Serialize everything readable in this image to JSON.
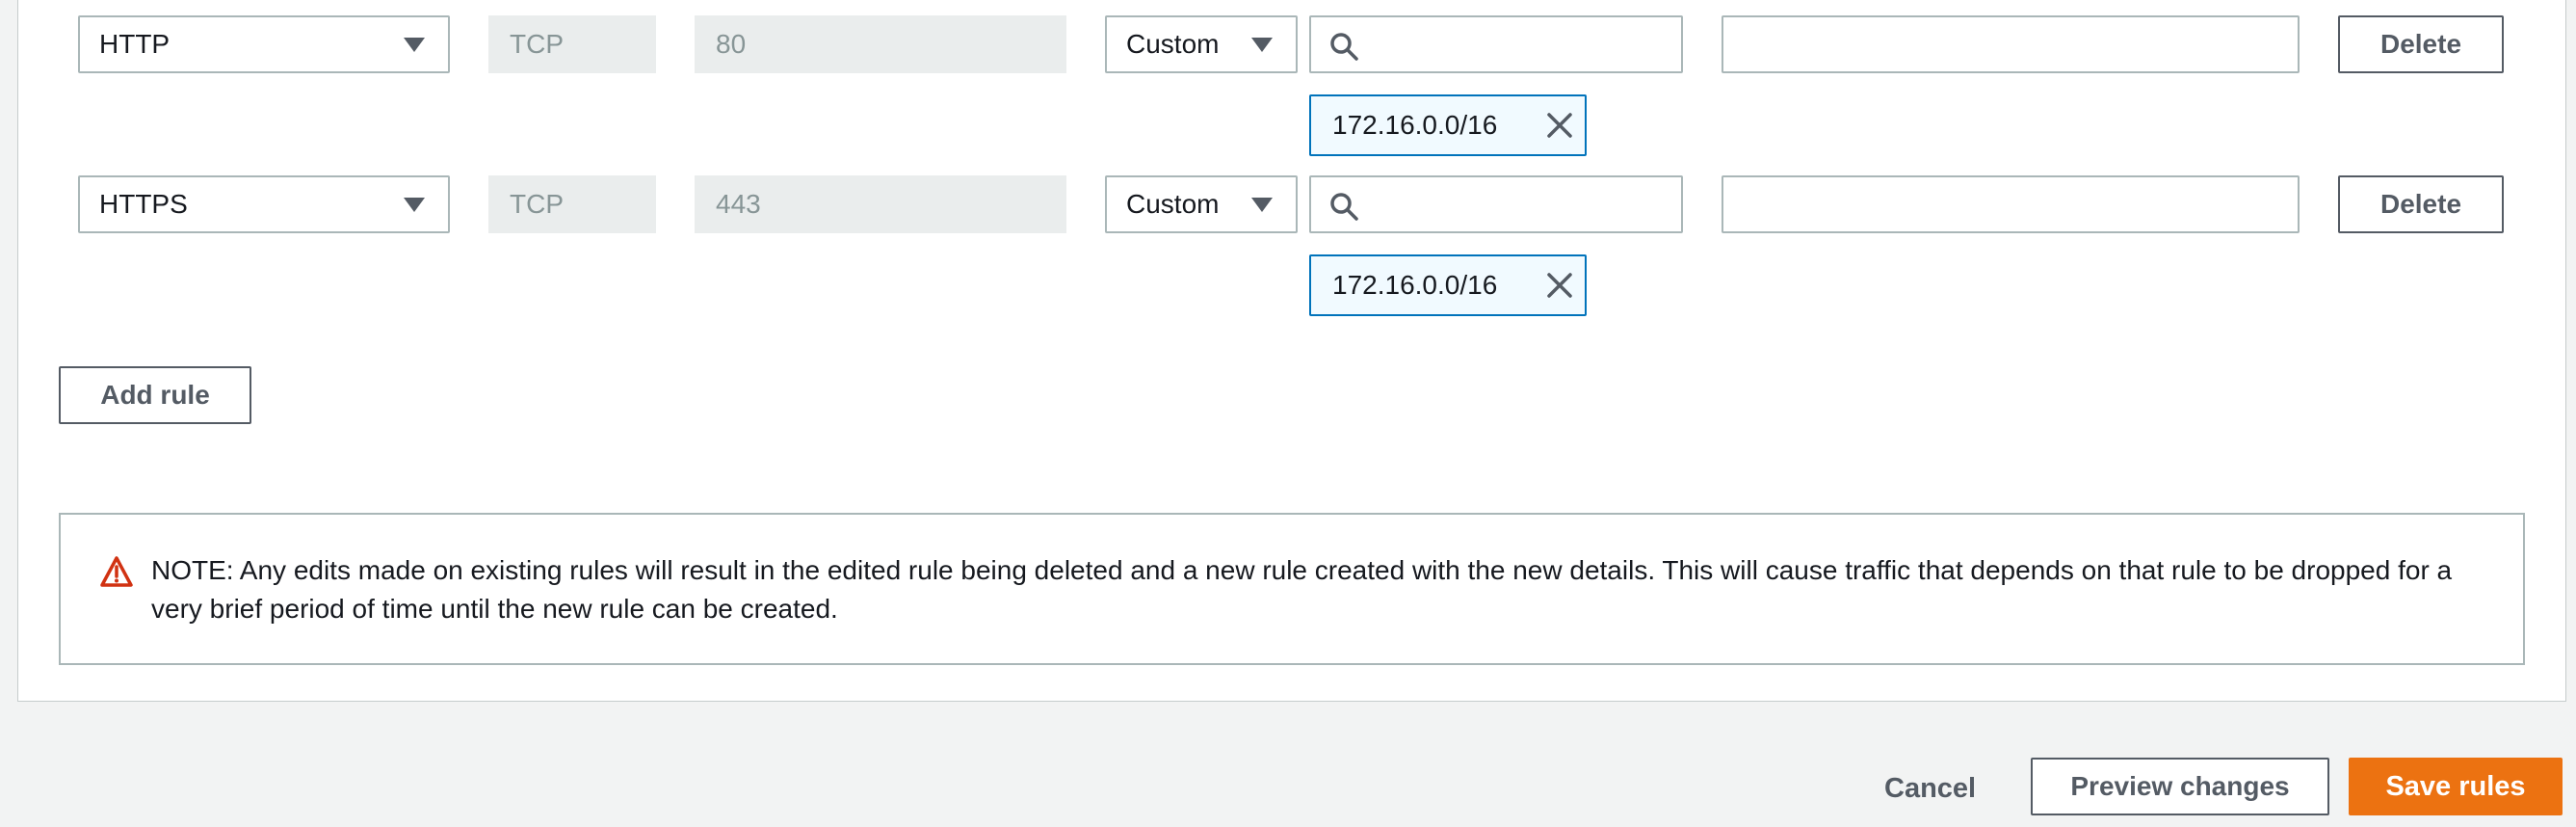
{
  "rules": [
    {
      "type": "HTTP",
      "protocol": "TCP",
      "port": "80",
      "source_mode": "Custom",
      "search_value": "",
      "description": "",
      "cidr_token": "172.16.0.0/16",
      "delete_label": "Delete"
    },
    {
      "type": "HTTPS",
      "protocol": "TCP",
      "port": "443",
      "source_mode": "Custom",
      "search_value": "",
      "description": "",
      "cidr_token": "172.16.0.0/16",
      "delete_label": "Delete"
    }
  ],
  "add_rule_label": "Add rule",
  "note": {
    "icon": "warning-triangle-icon",
    "icon_color": "#d13212",
    "text": "NOTE: Any edits made on existing rules will result in the edited rule being deleted and a new rule created with the new details. This will cause traffic that depends on that rule to be dropped for a very brief period of time until the new rule can be created."
  },
  "footer": {
    "cancel_label": "Cancel",
    "preview_label": "Preview changes",
    "save_label": "Save rules"
  },
  "colors": {
    "primary": "#ec7211",
    "token_border": "#0073bb",
    "token_bg": "#f1faff",
    "readonly_bg": "#eaeded"
  }
}
